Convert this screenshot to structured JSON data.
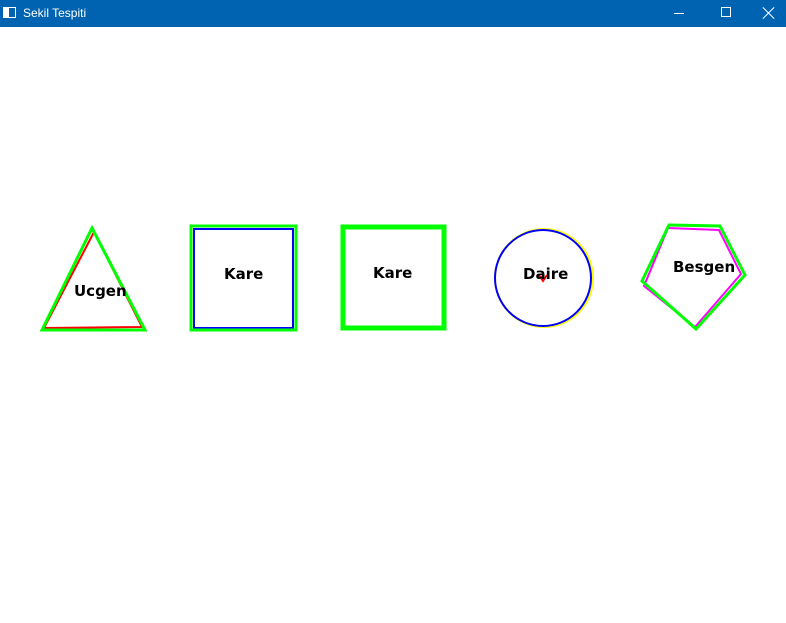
{
  "window": {
    "title": "Sekil Tespiti",
    "icon": "app-window-icon",
    "controls": [
      "minimize-icon",
      "maximize-icon",
      "close-icon"
    ]
  },
  "colors": {
    "titlebar": "#0063b1",
    "contour": "#00ff00",
    "inner_triangle": "#ff0000",
    "inner_square": "#0000ff",
    "circle_outer": "#ffff00",
    "circle_inner": "#0000ff",
    "center_mark": "#ff0000",
    "inner_pentagon": "#ff00ff",
    "label_text": "#000000"
  },
  "shapes": [
    {
      "id": "triangle",
      "label": "Ucgen"
    },
    {
      "id": "square-1",
      "label": "Kare"
    },
    {
      "id": "square-2",
      "label": "Kare"
    },
    {
      "id": "circle",
      "label": "Daire"
    },
    {
      "id": "pentagon",
      "label": "Besgen"
    }
  ]
}
